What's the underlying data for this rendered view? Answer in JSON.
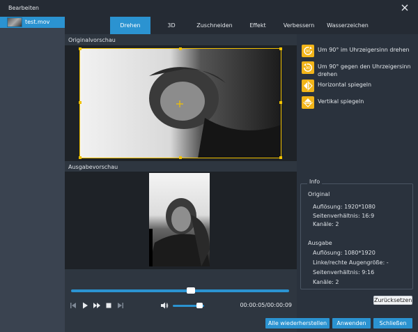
{
  "window": {
    "title": "Bearbeiten"
  },
  "sidebar": {
    "file_name": "test.mov"
  },
  "tabs": [
    {
      "label": "Drehen",
      "active": true
    },
    {
      "label": "3D"
    },
    {
      "label": "Zuschneiden"
    },
    {
      "label": "Effekt"
    },
    {
      "label": "Verbessern"
    },
    {
      "label": "Wasserzeichen"
    }
  ],
  "preview": {
    "original_label": "Originalvorschau",
    "output_label": "Ausgabevorschau"
  },
  "player": {
    "time": "00:00:05/00:00:09",
    "progress_percent": 55,
    "volume_percent": 85
  },
  "actions": [
    {
      "label": "Um 90° im Uhrzeigersinn drehen",
      "icon": "rotate-clockwise-icon"
    },
    {
      "label": "Um 90° gegen den Uhrzeigersinn drehen",
      "icon": "rotate-counterclockwise-icon"
    },
    {
      "label": "Horizontal spiegeln",
      "icon": "flip-horizontal-icon"
    },
    {
      "label": "Vertikal spiegeln",
      "icon": "flip-vertical-icon"
    }
  ],
  "info": {
    "title": "Info",
    "original_heading": "Original",
    "original_resolution": "Auflösung: 1920*1080",
    "original_aspect": "Seitenverhältnis: 16:9",
    "original_channels": "Kanäle: 2",
    "output_heading": "Ausgabe",
    "output_resolution": "Auflösung: 1080*1920",
    "output_eye": "Linke/rechte Augengröße: -",
    "output_aspect": "Seitenverhältnis: 9:16",
    "output_channels": "Kanäle: 2"
  },
  "buttons": {
    "reset": "Zurücksetzen",
    "restore_all": "Alle wiederherstellen",
    "apply": "Anwenden",
    "close": "Schließen"
  },
  "colors": {
    "accent": "#2b93d1",
    "selection": "#f2c200",
    "action_icon": "#f2b418"
  }
}
